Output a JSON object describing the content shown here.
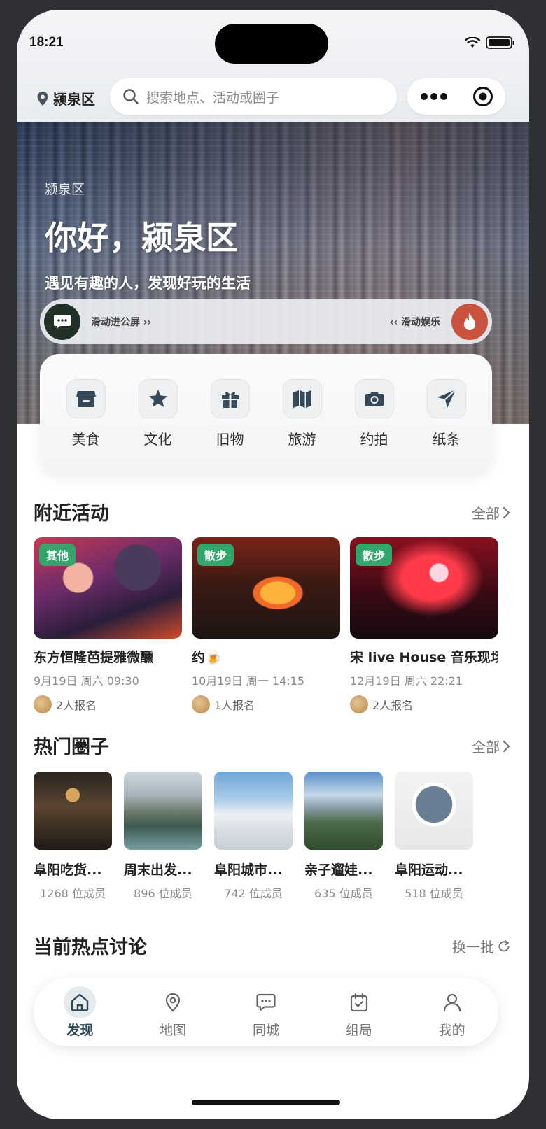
{
  "status": {
    "time": "18:21"
  },
  "header": {
    "location": "颍泉区",
    "search_placeholder": "搜索地点、活动或圈子"
  },
  "hero": {
    "subtitle": "颍泉区",
    "title": "你好，颍泉区",
    "tagline": "遇见有趣的人，发现好玩的生活",
    "slide_left": "滑动进公屏 ››",
    "slide_right": "‹‹ 滑动娱乐"
  },
  "categories": [
    {
      "label": "美食",
      "icon": "store-icon"
    },
    {
      "label": "文化",
      "icon": "star-icon"
    },
    {
      "label": "旧物",
      "icon": "gift-icon"
    },
    {
      "label": "旅游",
      "icon": "map-icon"
    },
    {
      "label": "约拍",
      "icon": "camera-icon"
    },
    {
      "label": "纸条",
      "icon": "send-icon"
    }
  ],
  "nearby": {
    "title": "附近活动",
    "more": "全部",
    "items": [
      {
        "tag": "其他",
        "title": "东方恒隆芭提雅微醺",
        "date": "9月19日 周六 09:30",
        "people": "2人报名"
      },
      {
        "tag": "散步",
        "title": "约🍺",
        "date": "10月19日 周一 14:15",
        "people": "1人报名"
      },
      {
        "tag": "散步",
        "title": "宋 live House 音乐现场",
        "date": "12月19日 周六 22:21",
        "people": "2人报名"
      }
    ]
  },
  "circles": {
    "title": "热门圈子",
    "more": "全部",
    "items": [
      {
        "name": "阜阳吃货...",
        "count": "1268 位成员"
      },
      {
        "name": "周末出发...",
        "count": "896 位成员"
      },
      {
        "name": "阜阳城市...",
        "count": "742 位成员"
      },
      {
        "name": "亲子遛娃...",
        "count": "635 位成员"
      },
      {
        "name": "阜阳运动...",
        "count": "518 位成员"
      }
    ]
  },
  "hot": {
    "title": "当前热点讨论",
    "refresh": "换一批"
  },
  "tabs": [
    {
      "label": "发现",
      "icon": "home-icon",
      "active": true
    },
    {
      "label": "地图",
      "icon": "location-pin-icon"
    },
    {
      "label": "同城",
      "icon": "chat-bubble-icon"
    },
    {
      "label": "组局",
      "icon": "calendar-check-icon"
    },
    {
      "label": "我的",
      "icon": "user-icon"
    }
  ],
  "colors": {
    "accent_green": "#33a66b",
    "fire_red": "#c9533f",
    "dark_green": "#223128"
  }
}
